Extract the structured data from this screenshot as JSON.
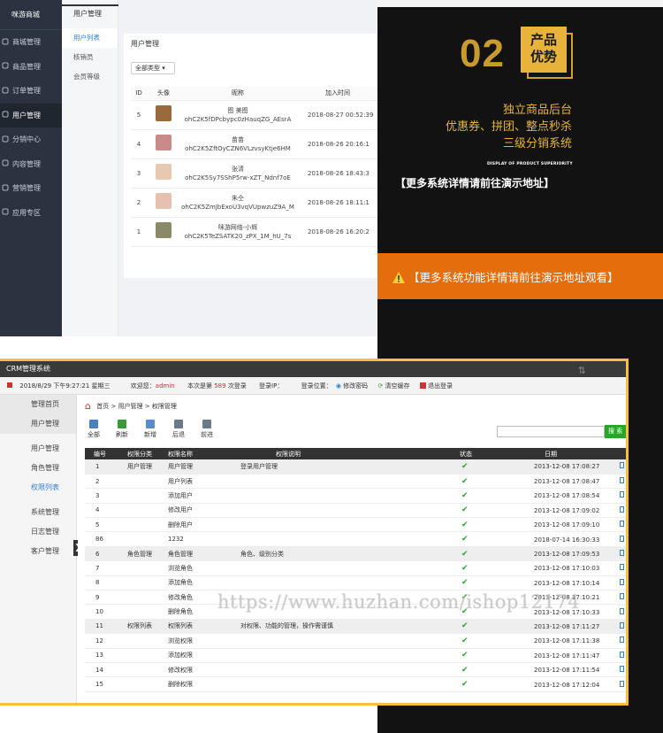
{
  "top_admin": {
    "brand": "咪游商城",
    "sidebar": [
      {
        "label": "商城管理",
        "icon": "gear-icon"
      },
      {
        "label": "商品管理",
        "icon": "box-icon"
      },
      {
        "label": "订单管理",
        "icon": "list-icon"
      },
      {
        "label": "用户管理",
        "icon": "user-icon",
        "active": true
      },
      {
        "label": "分销中心",
        "icon": "share-icon"
      },
      {
        "label": "内容管理",
        "icon": "doc-icon"
      },
      {
        "label": "营销管理",
        "icon": "tag-icon"
      },
      {
        "label": "应用专区",
        "icon": "grid-icon"
      }
    ],
    "subnav_header": "用户管理",
    "subnav": [
      {
        "label": "用户列表",
        "active": true
      },
      {
        "label": "核销员"
      },
      {
        "label": "会员等级"
      }
    ],
    "page_title": "用户管理",
    "filter_label": "全部类型 ▾",
    "columns": [
      "ID",
      "头像",
      "昵称",
      "加入时间"
    ],
    "rows": [
      {
        "id": "5",
        "name": "图 美图",
        "openid": "ohC2K5fDPcbypc0zHauqZG_AEsrA",
        "time": "2018-08-27 00:52:39",
        "color": "#9a6a3a"
      },
      {
        "id": "4",
        "name": "苗苗",
        "openid": "ohC2K5ZftOyCZN6VLzvsyKtje6HM",
        "time": "2018-08-26 20:16:1",
        "color": "#c98a8a"
      },
      {
        "id": "3",
        "name": "张清",
        "openid": "ohC2K5Sy7SShP5rw-xZT_Ndnf7oE",
        "time": "2018-08-26 18:43:3",
        "color": "#e8c8b0"
      },
      {
        "id": "2",
        "name": "朱仝",
        "openid": "ohC2K5ZmJbExoU3vqVUpwzuZ9A_M",
        "time": "2018-08-26 18:11:1",
        "color": "#e8c0b0"
      },
      {
        "id": "1",
        "name": "咪游网络-小辉",
        "openid": "ohC2K5TeZSATK20_zPX_1M_hU_7s",
        "time": "2018-08-26 16:20:2",
        "color": "#8a8a6a"
      }
    ]
  },
  "promo": {
    "number": "02",
    "badge": [
      "产品",
      "优势"
    ],
    "lines": [
      "独立商品后台",
      "优惠券、拼团、整点秒杀",
      "三级分销系统"
    ],
    "display_en": "DISPLAY OF PRODUCT SUPERIORITY",
    "more1": "【更多系统详情请前往演示地址】",
    "more2": "【更多系统功能详情请前往演示地址观看】"
  },
  "crm": {
    "title": "CRM管理系统",
    "datetime": "2018/8/29 下午9:27:21 星期三",
    "welcome": "欢迎您：",
    "user": "admin",
    "login_prefix": "本次是第",
    "login_count": "589",
    "login_suffix": "次登录",
    "ip_label": "登录IP：",
    "position_label": "登录位置：",
    "change_pwd": "修改密码",
    "clear_cache": "清空缓存",
    "logout": "退出登录",
    "sidebar": [
      {
        "label": "管理首页",
        "hd": true
      },
      {
        "label": "用户管理"
      },
      {
        "label": "用户管理"
      },
      {
        "label": "角色管理"
      },
      {
        "label": "权限列表",
        "active": true
      },
      {
        "label": "系统管理"
      },
      {
        "label": "日志管理"
      },
      {
        "label": "客户管理"
      }
    ],
    "breadcrumb": "首页 > 用户管理 > 权限管理",
    "tools": [
      {
        "label": "全部",
        "color": "#4a7fc0"
      },
      {
        "label": "刷新",
        "color": "#3a9a3a"
      },
      {
        "label": "新增",
        "color": "#5a8ad0"
      },
      {
        "label": "后退",
        "color": "#6a7a8a"
      },
      {
        "label": "前进",
        "color": "#6a7a8a"
      }
    ],
    "search_button": "搜 索",
    "columns": [
      "编号",
      "权限分类",
      "权限名称",
      "权限说明",
      "状态",
      "日期"
    ],
    "rows": [
      {
        "no": "1",
        "cat": "用户管理",
        "name": "用户管理",
        "desc": "登录用户管理",
        "date": "2013-12-08 17:08:27",
        "grp": true
      },
      {
        "no": "2",
        "cat": "",
        "name": "用户列表",
        "desc": "",
        "date": "2013-12-08 17:08:47"
      },
      {
        "no": "3",
        "cat": "",
        "name": "添加用户",
        "desc": "",
        "date": "2013-12-08 17:08:54"
      },
      {
        "no": "4",
        "cat": "",
        "name": "修改用户",
        "desc": "",
        "date": "2013-12-08 17:09:02"
      },
      {
        "no": "5",
        "cat": "",
        "name": "删除用户",
        "desc": "",
        "date": "2013-12-08 17:09:10"
      },
      {
        "no": "86",
        "cat": "",
        "name": "1232",
        "desc": "",
        "date": "2018-07-14 16:30:33"
      },
      {
        "no": "6",
        "cat": "角色管理",
        "name": "角色管理",
        "desc": "角色、级别分类",
        "date": "2013-12-08 17:09:53",
        "grp": true
      },
      {
        "no": "7",
        "cat": "",
        "name": "浏览角色",
        "desc": "",
        "date": "2013-12-08 17:10:03"
      },
      {
        "no": "8",
        "cat": "",
        "name": "添加角色",
        "desc": "",
        "date": "2013-12-08 17:10:14"
      },
      {
        "no": "9",
        "cat": "",
        "name": "修改角色",
        "desc": "",
        "date": "2013-12-08 17:10:21"
      },
      {
        "no": "10",
        "cat": "",
        "name": "删除角色",
        "desc": "",
        "date": "2013-12-08 17:10:33"
      },
      {
        "no": "11",
        "cat": "权限列表",
        "name": "权限列表",
        "desc": "对权限、功能的管理，操作需谨慎",
        "date": "2013-12-08 17:11:27",
        "grp": true
      },
      {
        "no": "12",
        "cat": "",
        "name": "浏览权限",
        "desc": "",
        "date": "2013-12-08 17:11:38"
      },
      {
        "no": "13",
        "cat": "",
        "name": "添加权限",
        "desc": "",
        "date": "2013-12-08 17:11:47"
      },
      {
        "no": "14",
        "cat": "",
        "name": "修改权限",
        "desc": "",
        "date": "2013-12-08 17:11:54"
      },
      {
        "no": "15",
        "cat": "",
        "name": "删除权限",
        "desc": "",
        "date": "2013-12-08 17:12:04"
      }
    ]
  },
  "watermark": "https://www.huzhan.com/ishop12174"
}
